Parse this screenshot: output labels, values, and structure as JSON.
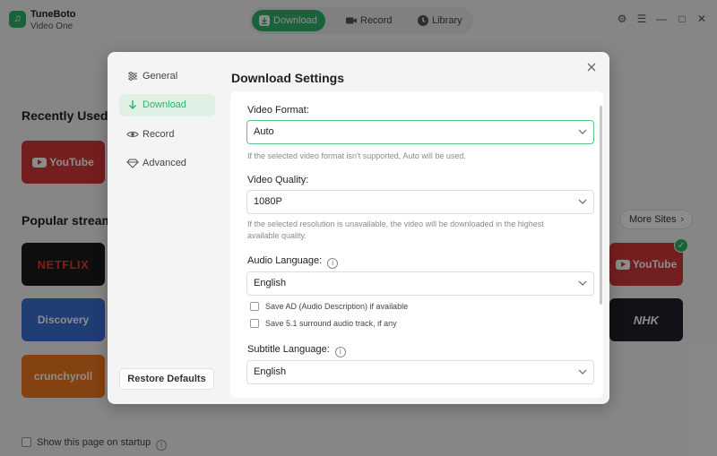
{
  "app": {
    "name_line1": "TuneBoto",
    "name_line2": "Video One",
    "logo_glyph": "♫",
    "accent_color": "#2fb36a"
  },
  "nav": {
    "download": "Download",
    "record": "Record",
    "library": "Library"
  },
  "background": {
    "recently_used_title": "Recently Used",
    "popular_title": "Popular stream",
    "more_sites": "More Sites",
    "tiles": {
      "youtube": "YouTube",
      "netflix": "NETFLIX",
      "discovery": "Discovery",
      "crunchyroll": "crunchyroll",
      "nhk": "NHK"
    },
    "startup_label": "Show this page on startup"
  },
  "modal": {
    "title": "Download Settings",
    "sidebar": [
      {
        "label": "General",
        "icon": "sliders-icon",
        "active": false
      },
      {
        "label": "Download",
        "icon": "arrow-down-icon",
        "active": true
      },
      {
        "label": "Record",
        "icon": "eye-icon",
        "active": false
      },
      {
        "label": "Advanced",
        "icon": "diamond-icon",
        "active": false
      }
    ],
    "restore_defaults": "Restore Defaults",
    "video_format": {
      "label": "Video Format:",
      "value": "Auto",
      "hint": "If the selected video format isn't supported, Auto will be used."
    },
    "video_quality": {
      "label": "Video Quality:",
      "value": "1080P",
      "hint": "If the selected resolution is unavailable, the video will be downloaded in the highest available quality."
    },
    "audio_language": {
      "label": "Audio Language:",
      "value": "English",
      "options": [
        {
          "label": "Save AD (Audio Description) if available",
          "checked": false
        },
        {
          "label": "Save 5.1 surround audio track, if any",
          "checked": false
        }
      ]
    },
    "subtitle_language": {
      "label": "Subtitle Language:",
      "value": "English"
    }
  }
}
